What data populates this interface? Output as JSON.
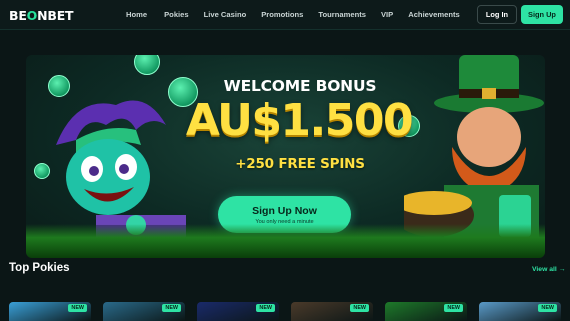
{
  "brand": {
    "logo_left": "BE",
    "logo_o": "O",
    "logo_right": "NBET"
  },
  "nav": {
    "items": [
      "Home",
      "Pokies",
      "Live Casino",
      "Promotions",
      "Tournaments",
      "VIP",
      "Achievements"
    ]
  },
  "auth": {
    "login_label": "Log In",
    "signup_label": "Sign Up"
  },
  "hero": {
    "line1": "WELCOME BONUS",
    "amount": "AU$1.500",
    "line3": "+250 FREE SPINS",
    "cta_label": "Sign Up Now",
    "cta_sub": "You only need a minute"
  },
  "section": {
    "title": "Top Pokies",
    "view_all": "View all →"
  },
  "cards": [
    {
      "badge": "NEW",
      "color": "#3aa0d8"
    },
    {
      "badge": "NEW",
      "color": "#2a6a8a"
    },
    {
      "badge": "NEW",
      "color": "#1a2a6a"
    },
    {
      "badge": "NEW",
      "color": "#4a3a2a"
    },
    {
      "badge": "NEW",
      "color": "#1e7a2a"
    },
    {
      "badge": "NEW",
      "color": "#5a9ac8"
    }
  ],
  "colors": {
    "accent": "#2ee3a4",
    "background": "#0b1616",
    "gold": "#ffe042"
  }
}
